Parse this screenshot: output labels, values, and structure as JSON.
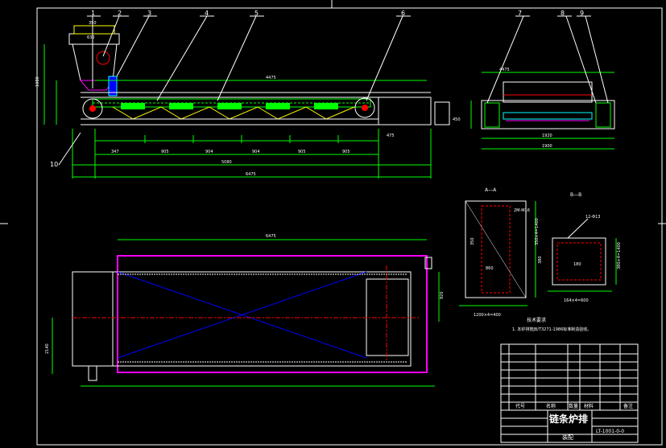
{
  "drawing": {
    "callouts": [
      "1",
      "2",
      "3",
      "4",
      "5",
      "6",
      "7",
      "8",
      "9",
      "10"
    ],
    "dims": {
      "main_length": "4475",
      "total_length": "5080",
      "overall_length": "6475",
      "top_length": "4475",
      "side_width": "1920",
      "end_width": "1900",
      "plan_width": "2140",
      "plan_side": "920",
      "plan_length": "6475",
      "seg_1": "347",
      "seg_2": "905",
      "seg_3": "904",
      "seg_4": "904",
      "seg_5": "905",
      "seg_6": "905",
      "height_left": "1080",
      "hopper_top": "350",
      "hopper_mid": "632",
      "right_h": "450",
      "right_step": "475"
    },
    "section_a_title": "A—A",
    "section_b_title": "B—B",
    "section_a_notes": [
      "2M-M16",
      "350×4=1400",
      "1200×4=400",
      "860",
      "350"
    ],
    "section_b_notes": [
      "12-Φ13",
      "380",
      "180",
      "380×4=1400",
      "164×4=600"
    ],
    "notes_title": "技术要求",
    "notes_line": "1. 本炉排按JB/T3271-1986标准制造验收。",
    "title_block": {
      "product_name": "链条炉排",
      "drawing_no": "LT-1001-0-0",
      "sub_title": "装配",
      "col_no": "代号",
      "col_name": "名称",
      "col_qty": "数量",
      "col_material": "材料",
      "col_note": "备注"
    }
  }
}
